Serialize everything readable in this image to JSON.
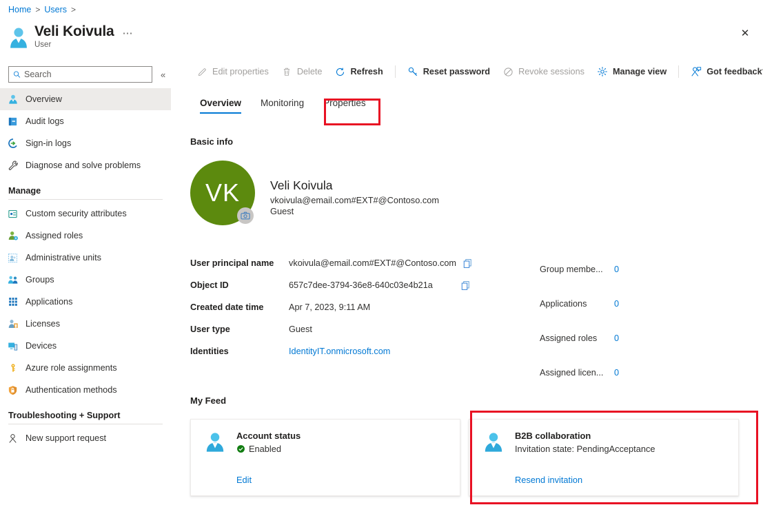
{
  "breadcrumb": {
    "items": [
      "Home",
      "Users"
    ],
    "separator": ">"
  },
  "resource": {
    "title": "Veli Koivula",
    "subtitle": "User",
    "more_label": "⋯",
    "avatar_icon": "user-icon"
  },
  "search": {
    "placeholder": "Search",
    "value": "",
    "icon": "search-icon"
  },
  "collapse": {
    "label": "«",
    "icon": "double-chevron-left-icon"
  },
  "close": {
    "label": "✕",
    "icon": "close-icon"
  },
  "sidebar": {
    "items": [
      {
        "label": "Overview",
        "icon": "user-icon",
        "selected": true
      },
      {
        "label": "Audit logs",
        "icon": "book-icon",
        "selected": false
      },
      {
        "label": "Sign-in logs",
        "icon": "sign-in-icon",
        "selected": false
      },
      {
        "label": "Diagnose and solve problems",
        "icon": "wrench-icon",
        "selected": false
      }
    ],
    "groups": [
      {
        "label": "Manage",
        "items": [
          {
            "label": "Custom security attributes",
            "icon": "security-attributes-icon"
          },
          {
            "label": "Assigned roles",
            "icon": "assigned-roles-icon"
          },
          {
            "label": "Administrative units",
            "icon": "administrative-units-icon"
          },
          {
            "label": "Groups",
            "icon": "groups-icon"
          },
          {
            "label": "Applications",
            "icon": "applications-grid-icon"
          },
          {
            "label": "Licenses",
            "icon": "licenses-icon"
          },
          {
            "label": "Devices",
            "icon": "devices-icon"
          },
          {
            "label": "Azure role assignments",
            "icon": "key-icon"
          },
          {
            "label": "Authentication methods",
            "icon": "shield-lock-icon"
          }
        ]
      },
      {
        "label": "Troubleshooting + Support",
        "items": [
          {
            "label": "New support request",
            "icon": "support-person-icon"
          }
        ]
      }
    ]
  },
  "toolbar": {
    "commands": [
      {
        "label": "Edit properties",
        "icon": "pencil-icon",
        "disabled": true
      },
      {
        "label": "Delete",
        "icon": "trash-icon",
        "disabled": true
      },
      {
        "label": "Refresh",
        "icon": "refresh-icon",
        "disabled": false
      },
      {
        "divider": true
      },
      {
        "label": "Reset password",
        "icon": "key-reset-icon",
        "disabled": false
      },
      {
        "label": "Revoke sessions",
        "icon": "block-icon",
        "disabled": true
      },
      {
        "label": "Manage view",
        "icon": "gear-icon",
        "disabled": false
      },
      {
        "divider": true
      },
      {
        "label": "Got feedback?",
        "icon": "feedback-person-icon",
        "disabled": false
      }
    ]
  },
  "tabs": [
    {
      "label": "Overview",
      "active": true
    },
    {
      "label": "Monitoring",
      "active": false
    },
    {
      "label": "Properties",
      "active": false,
      "highlighted": true
    }
  ],
  "sections": {
    "basic_info": "Basic info",
    "my_feed": "My Feed"
  },
  "profile": {
    "initials": "VK",
    "avatar_color": "#5c8a0e",
    "name": "Veli Koivula",
    "email": "vkoivula@email.com#EXT#@Contoso.com",
    "user_type": "Guest",
    "camera_icon": "camera-icon"
  },
  "properties_left": [
    {
      "key": "User principal name",
      "value": "vkoivula@email.com#EXT#@Contoso.com",
      "copy": true,
      "link": false
    },
    {
      "key": "Object ID",
      "value": "657c7dee-3794-36e8-640c03e4b21a",
      "copy": true,
      "link": false
    },
    {
      "key": "Created date time",
      "value": "Apr 7, 2023, 9:11 AM",
      "copy": false,
      "link": false
    },
    {
      "key": "User type",
      "value": "Guest",
      "copy": false,
      "link": false
    },
    {
      "key": "Identities",
      "value": "IdentityIT.onmicrosoft.com",
      "copy": false,
      "link": true
    }
  ],
  "properties_right": [
    {
      "key": "Group membe...",
      "value": "0"
    },
    {
      "key": "Applications",
      "value": "0"
    },
    {
      "key": "Assigned roles",
      "value": "0"
    },
    {
      "key": "Assigned licen...",
      "value": "0"
    }
  ],
  "feed_cards": [
    {
      "title": "Account status",
      "status": "Enabled",
      "status_icon": "check-circle-icon",
      "link": "Edit",
      "icon": "user-avatar-icon",
      "highlighted": false
    },
    {
      "title": "B2B collaboration",
      "status": "Invitation state: PendingAcceptance",
      "status_icon": "",
      "link": "Resend invitation",
      "icon": "user-avatar-icon",
      "highlighted": true
    }
  ],
  "colors": {
    "accent": "#0078d4",
    "highlight_red": "#e81123",
    "avatar_green": "#5c8a0e",
    "status_green": "#107c10",
    "disabled_gray": "#a19f9d"
  }
}
